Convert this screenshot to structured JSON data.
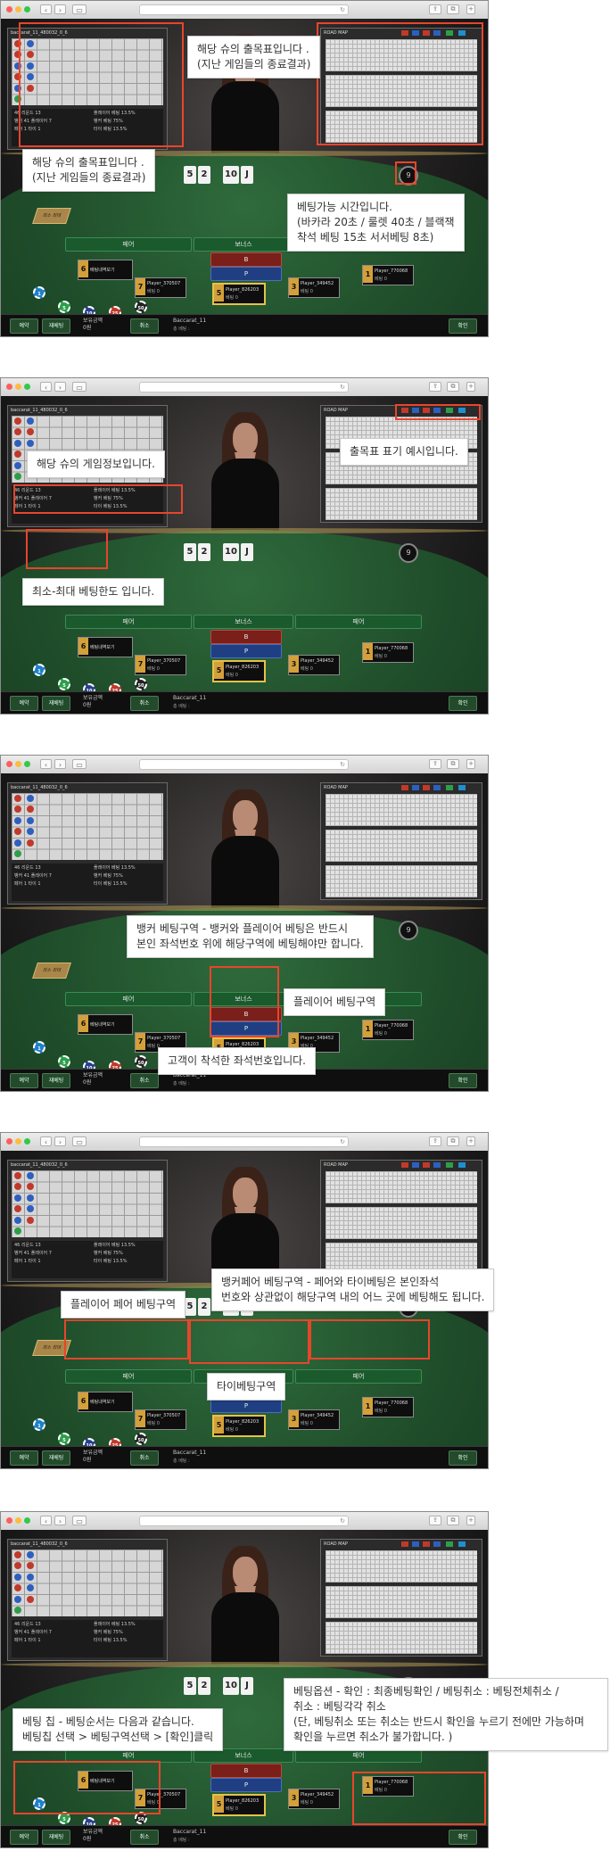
{
  "colors": {
    "highlight": "#e8452c",
    "felt": "#1f4d2a",
    "seat_number": "#d4a03a",
    "banker": "#c0392b",
    "player": "#2e5fbf"
  },
  "table": {
    "shoe_id": "baccarat_11_480032_0_6",
    "roadmap_title": "ROAD MAP",
    "name": "Baccarat_11",
    "sub": "총 베팅 :",
    "balance_label": "보유금액",
    "balance_value": "0원",
    "cards": [
      "5",
      "2",
      "10",
      "J"
    ],
    "timer": "9",
    "limit_label": "최소 최대",
    "buttons": {
      "seat_reserve": "예약",
      "rebet": "재베팅",
      "cancel": "취소",
      "confirm": "확인",
      "bet_history": "베팅내역보기"
    },
    "zones": {
      "banker": "B",
      "player": "P",
      "tie": "보너스",
      "pair": "페어"
    },
    "chips": [
      "1",
      "5",
      "10",
      "25",
      "50"
    ],
    "stats": {
      "s1": "46 리운드 13",
      "s2": "뱅커 41 플레이어 7",
      "s3": "페어 1 타이 1",
      "s4": "플레이어 베팅 13.5%",
      "s5": "뱅커 베팅 75%",
      "s6": "타이 베팅 13.5%"
    },
    "players": [
      {
        "num": "7",
        "name": "Player_370507",
        "bet": "베팅 0"
      },
      {
        "num": "5",
        "name": "Player_826203",
        "bet": "베팅 0"
      },
      {
        "num": "3",
        "name": "Player_349452",
        "bet": "베팅 0"
      },
      {
        "num": "1",
        "name": "Player_770068",
        "bet": "베팅 0"
      },
      {
        "num": "6",
        "name": "Player_416315",
        "bet": "베팅 0"
      }
    ]
  },
  "captions": {
    "s1_roadmap": {
      "line1": "해당 슈의 출목표입니다 .",
      "line2": "(지난 게임들의 종료결과)"
    },
    "s1_roadmap2": {
      "line1": "해당 슈의 출목표입니다 .",
      "line2": "(지난 게임들의 종료결과)"
    },
    "s1_timer": {
      "line1": "베팅가능 시간입니다.",
      "line2": "(바카라 20초 / 룰렛 40초 /  블랙잭",
      "line3": "착석 베팅 15초 서서베팅 8초)"
    },
    "s2_info": "해당 슈의 게임정보입니다.",
    "s2_legend": "출목표 표기 예시입니다.",
    "s2_limit": "최소-최대 베팅한도 입니다.",
    "s3_banker": {
      "line1": "뱅커 베팅구역 - 뱅커와 플레이어 베팅은 반드시",
      "line2": "본인 좌석번호 위에 해당구역에 베팅해야만 합니다."
    },
    "s3_player": "플레이어 베팅구역",
    "s3_seat": "고객이 착석한 좌석번호입니다.",
    "s4_ppair": "플레이어 페어 베팅구역",
    "s4_bpair": {
      "line1": "뱅커페어 베팅구역 - 페어와 타이베팅은 본인좌석",
      "line2": "번호와 상관없이 해당구역 내의 어느 곳에  베팅해도 됩니다."
    },
    "s4_tie": "타이베팅구역",
    "s5_chip": {
      "line1": "베팅 칩 - 베팅순서는 다음과 같습니다.",
      "line2": "베팅칩 선택  >  베팅구역선택   >  [확인]클릭"
    },
    "s5_option": {
      "line1": "베팅옵션 - 확인 :  최종베팅확인 /  베팅취소 :  베팅전체취소 /",
      "line2": "취소 : 베팅각각 취소",
      "line3": "(단, 베팅취소 또는 취소는 반드시 확인을 누르기 전에만 가능하며",
      "line4": "확인을 누르면 취소가 불가합니다.  )"
    }
  }
}
